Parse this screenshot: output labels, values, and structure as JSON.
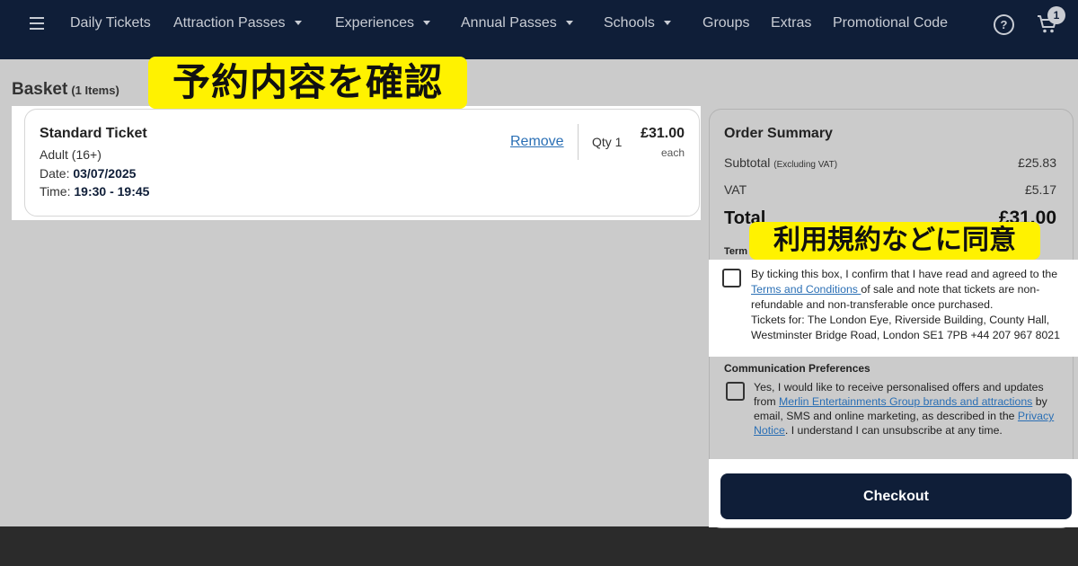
{
  "nav": {
    "items": [
      {
        "label": "Daily Tickets",
        "dropdown": false
      },
      {
        "label": "Attraction Passes",
        "dropdown": true
      },
      {
        "label": "Experiences",
        "dropdown": true
      },
      {
        "label": "Annual Passes",
        "dropdown": true
      },
      {
        "label": "Schools",
        "dropdown": true
      },
      {
        "label": "Groups",
        "dropdown": false
      },
      {
        "label": "Extras",
        "dropdown": false
      },
      {
        "label": "Promotional Code",
        "dropdown": false
      }
    ],
    "help_icon": "?",
    "cart_count": "1"
  },
  "basket": {
    "title": "Basket",
    "count": "(1 Items)"
  },
  "annotations": {
    "confirm_booking": "予約内容を確認",
    "agree_terms": "利用規約などに同意"
  },
  "ticket": {
    "name": "Standard Ticket",
    "type": "Adult (16+)",
    "date_label": "Date:",
    "date": "03/07/2025",
    "time_label": "Time:",
    "time": "19:30 - 19:45",
    "remove": "Remove",
    "qty": "Qty 1",
    "price": "£31.00",
    "price_unit": "each"
  },
  "summary": {
    "title": "Order Summary",
    "subtotal_label": "Subtotal",
    "subtotal_note": "(Excluding VAT)",
    "subtotal": "£25.83",
    "vat_label": "VAT",
    "vat": "£5.17",
    "total_label": "Total",
    "total": "£31.00",
    "terms_heading": "Term",
    "terms_pre": "By ticking this box, I confirm that I have read and agreed to the ",
    "terms_link": "Terms and Conditions ",
    "terms_post": "of sale and note that tickets are non-refundable and non-transferable once purchased.",
    "terms_tickets_for": "Tickets for: The London Eye, Riverside Building, County Hall, Westminster Bridge Road, London SE1 7PB +44 207 967 8021",
    "comm_heading": "Communication Preferences",
    "comm_pre": "Yes, I would like to receive personalised offers and updates from ",
    "comm_link": "Merlin Entertainments Group brands and attractions",
    "comm_mid": " by email, SMS and online marketing, as described in the ",
    "comm_link2": "Privacy Notice",
    "comm_post": ". I understand I can unsubscribe at any time.",
    "checkout": "Checkout"
  },
  "colors": {
    "nav_bg": "#0f1e38",
    "highlight": "#fff200",
    "link": "#2a6fb5",
    "checkout_bg": "#0f1e38"
  }
}
